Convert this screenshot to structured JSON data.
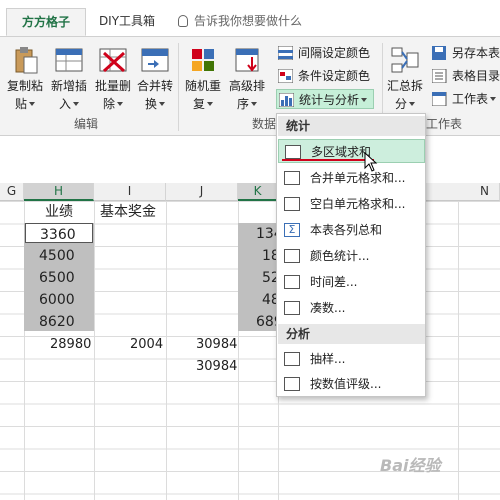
{
  "tabs": {
    "active": "方方格子",
    "second": "DIY工具箱",
    "tell_me": "告诉我你想要做什么"
  },
  "ribbon": {
    "edit_group": {
      "label": "编辑",
      "buttons": [
        {
          "line1": "复制粘",
          "line2": "贴"
        },
        {
          "line1": "新增插",
          "line2": "入"
        },
        {
          "line1": "批量删",
          "line2": "除"
        },
        {
          "line1": "合并转",
          "line2": "换"
        }
      ]
    },
    "data_group": {
      "label": "数据",
      "buttons": [
        {
          "line1": "随机重",
          "line2": "复"
        },
        {
          "line1": "高级排",
          "line2": "序"
        }
      ],
      "small_buttons": [
        "间隔设定颜色",
        "条件设定颜色",
        "统计与分析"
      ]
    },
    "summary_button": {
      "line1": "汇总拆",
      "line2": "分"
    },
    "sheet_group": {
      "label": "工作表",
      "items": [
        "另存本表",
        "表格目录",
        "工作表"
      ]
    }
  },
  "sheet": {
    "columns": [
      "G",
      "H",
      "I",
      "J",
      "K",
      "N"
    ],
    "headers": {
      "h": "业绩",
      "i": "基本奖金"
    },
    "h_values": [
      "3360",
      "4500",
      "6500",
      "6000",
      "8620"
    ],
    "k_values": [
      "134",
      "18",
      "52",
      "48",
      "689"
    ],
    "h_sum": "28980",
    "i_sum": "2004",
    "j_sum1": "30984",
    "j_sum2": "30984"
  },
  "dropdown": {
    "section_stats": "统计",
    "stats_items": [
      "多区域求和",
      "合并单元格求和...",
      "空白单元格求和...",
      "本表各列总和",
      "颜色统计...",
      "时间差...",
      "凑数..."
    ],
    "section_analysis": "分析",
    "analysis_items": [
      "抽样...",
      "按数值评级..."
    ]
  },
  "watermark": "Bai经验"
}
